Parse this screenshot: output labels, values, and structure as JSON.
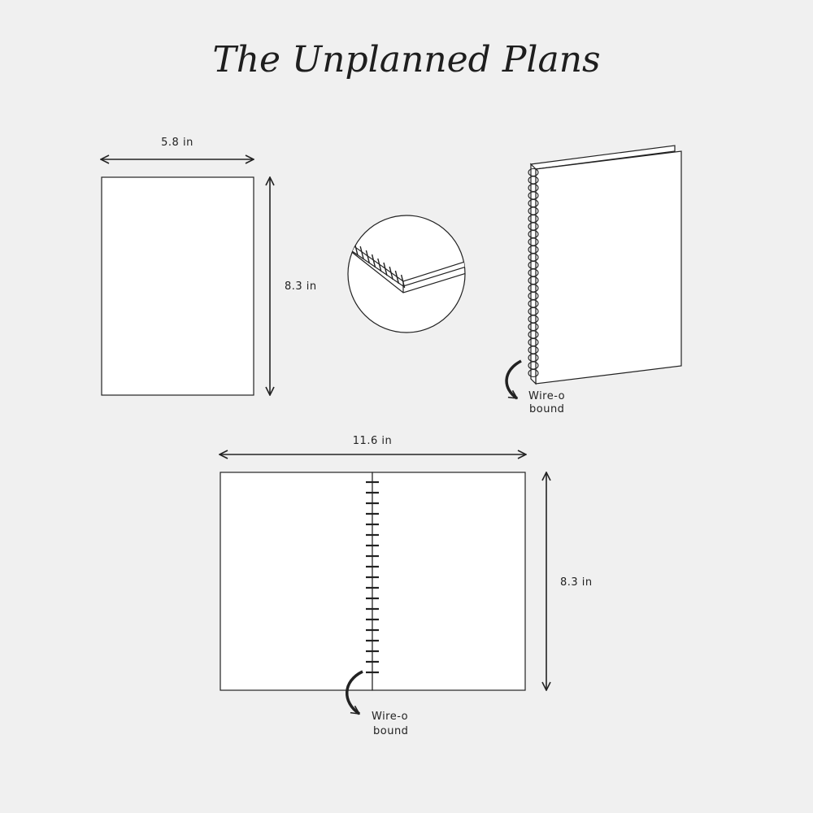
{
  "title": "The Unplanned Plans",
  "closed_view": {
    "width_label": "5.8 in",
    "height_label": "8.3 in"
  },
  "perspective_view": {
    "binding_label_line1": "Wire-o",
    "binding_label_line2": "bound"
  },
  "open_view": {
    "width_label": "11.6 in",
    "height_label": "8.3 in",
    "binding_label_line1": "Wire-o",
    "binding_label_line2": "bound"
  },
  "colors": {
    "background": "#f0f0f0",
    "page": "#ffffff",
    "line": "#222222"
  }
}
